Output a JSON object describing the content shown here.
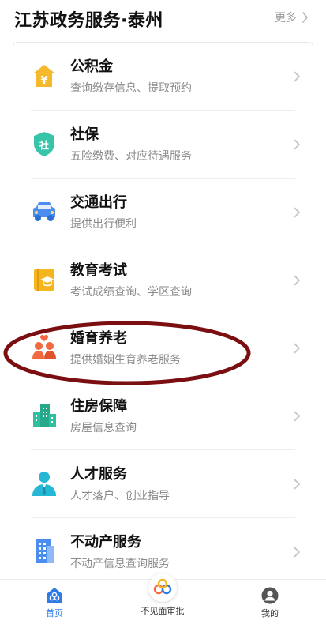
{
  "header": {
    "title": "江苏政务服务·泰州",
    "more_label": "更多"
  },
  "services": [
    {
      "title": "公积金",
      "desc": "查询缴存信息、提取预约",
      "icon": "provident-fund-icon",
      "color": "#F6B92B"
    },
    {
      "title": "社保",
      "desc": "五险缴费、对应待遇服务",
      "icon": "social-security-shield-icon",
      "color": "#38C4A8"
    },
    {
      "title": "交通出行",
      "desc": "提供出行便利",
      "icon": "car-icon",
      "color": "#4C8DF0"
    },
    {
      "title": "教育考试",
      "desc": "考试成绩查询、学区查询",
      "icon": "education-book-icon",
      "color": "#F5B51F"
    },
    {
      "title": "婚育养老",
      "desc": "提供婚姻生育养老服务",
      "icon": "family-icon",
      "color": "#F2683F"
    },
    {
      "title": "住房保障",
      "desc": "房屋信息查询",
      "icon": "buildings-icon",
      "color": "#2EC0A0"
    },
    {
      "title": "人才服务",
      "desc": "人才落户、创业指导",
      "icon": "person-icon",
      "color": "#27B7D6"
    },
    {
      "title": "不动产服务",
      "desc": "不动产信息查询服务",
      "icon": "real-estate-building-icon",
      "color": "#4C8DF0"
    }
  ],
  "tabbar": {
    "home_label": "首页",
    "center_label": "不见面审批",
    "mine_label": "我的",
    "active_color": "#2E7BE6"
  },
  "annotation": {
    "color": "#7A0E10",
    "target": "婚育养老"
  }
}
